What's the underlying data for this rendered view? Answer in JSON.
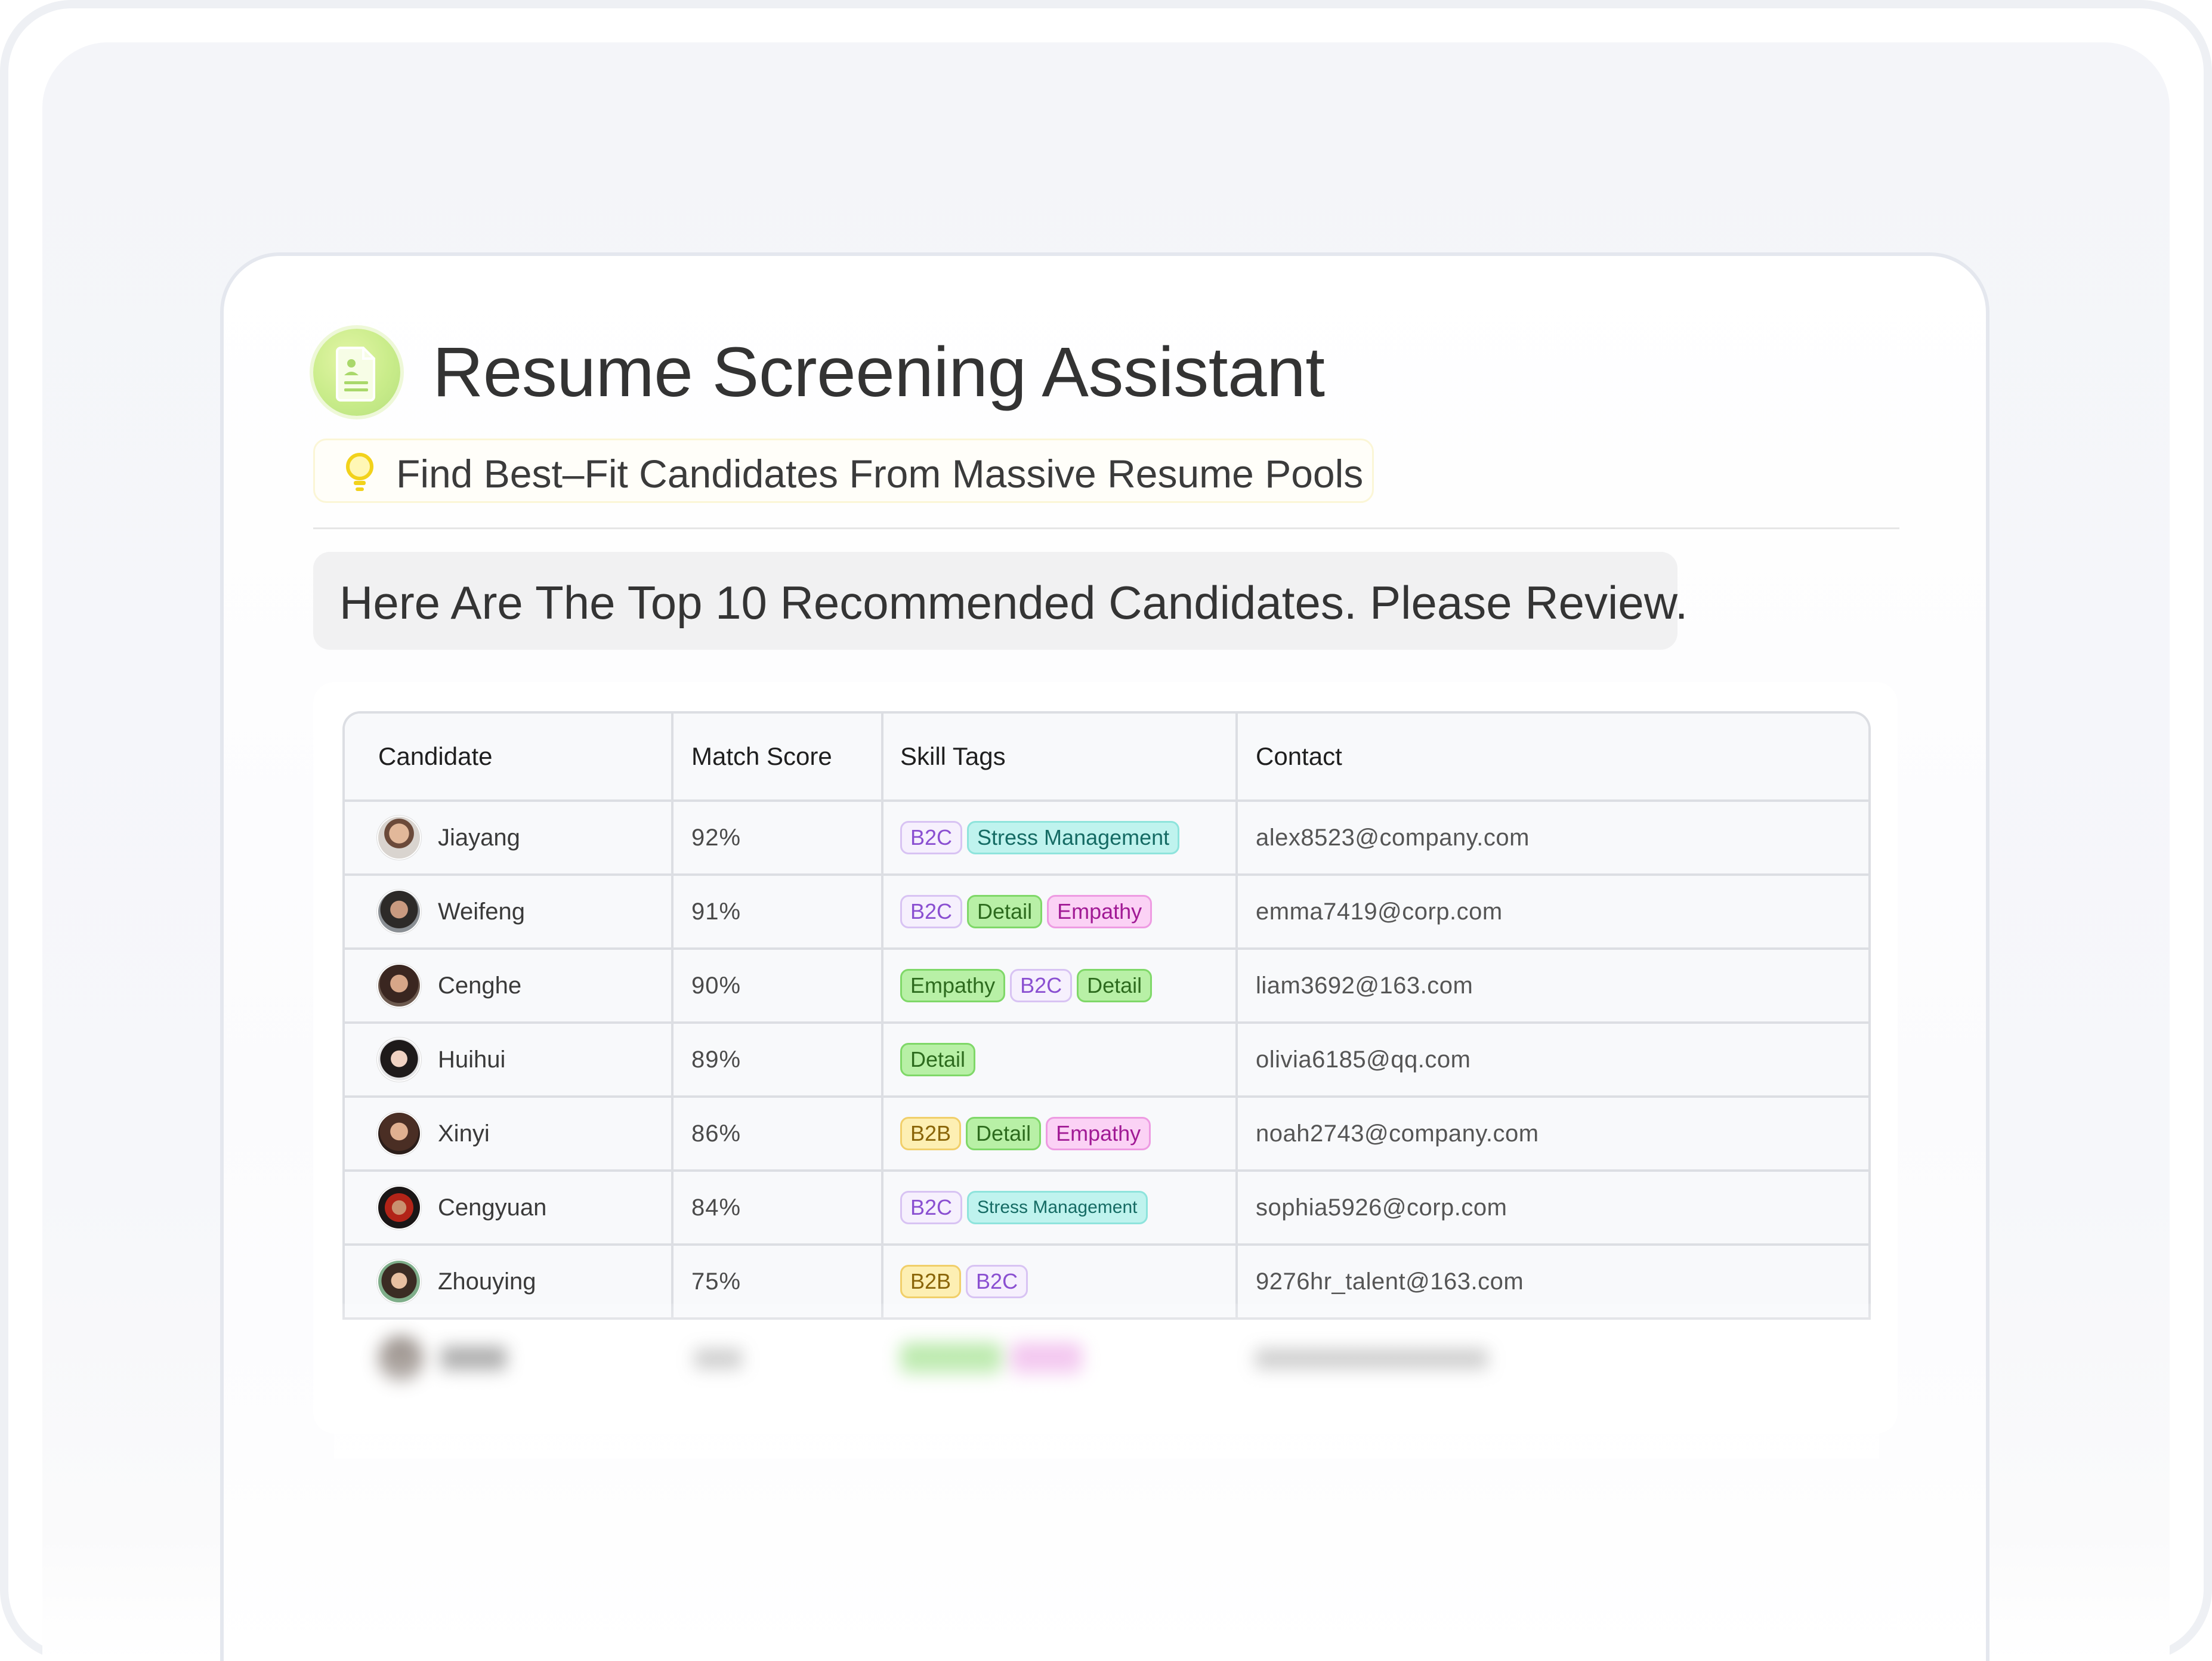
{
  "app": {
    "title": "Resume Screening Assistant",
    "subtitle": "Find Best–Fit Candidates From Massive Resume Pools",
    "icon": "resume-document-icon",
    "accent": "#c9ec8a"
  },
  "message": "Here Are The Top 10 Recommended Candidates. Please Review.",
  "table": {
    "headers": [
      "Candidate",
      "Match Score",
      "Skill Tags",
      "Contact"
    ],
    "rows": [
      {
        "name": "Jiayang",
        "score": "92%",
        "tags": [
          "B2C",
          "Stress Management"
        ],
        "email": "alex8523@company.com"
      },
      {
        "name": "Weifeng",
        "score": "91%",
        "tags": [
          "B2C",
          "Detail",
          "Empathy"
        ],
        "email": "emma7419@corp.com"
      },
      {
        "name": "Cenghe",
        "score": "90%",
        "tags": [
          "Empathy",
          "B2C",
          "Detail"
        ],
        "email": "liam3692@163.com"
      },
      {
        "name": "Huihui",
        "score": "89%",
        "tags": [
          "Detail"
        ],
        "email": "olivia6185@qq.com"
      },
      {
        "name": "Xinyi",
        "score": "86%",
        "tags": [
          "B2B",
          "Detail",
          "Empathy"
        ],
        "email": "noah2743@company.com"
      },
      {
        "name": "Cengyuan",
        "score": "84%",
        "tags": [
          "B2C",
          "Stress Management"
        ],
        "email": "sophia5926@corp.com"
      },
      {
        "name": "Zhouying",
        "score": "75%",
        "tags": [
          "B2B",
          "B2C"
        ],
        "email": "9276hr_talent@163.com"
      }
    ]
  },
  "colors": {
    "tag_b2c": "#8a4fd1",
    "tag_b2b": "#f1cf6a",
    "tag_stress": "#bff3ee",
    "tag_detail": "#b8f0a6",
    "tag_empathy": "#fbd2f5"
  }
}
